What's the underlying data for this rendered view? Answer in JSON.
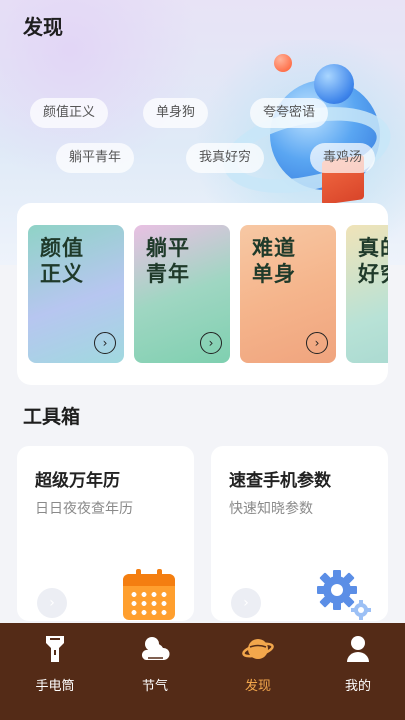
{
  "page": {
    "title": "发现"
  },
  "tags": [
    "颜值正义",
    "单身狗",
    "夸夸密语",
    "躺平青年",
    "我真好穷",
    "毒鸡汤"
  ],
  "featured_cards": [
    {
      "title": "颜值正义"
    },
    {
      "title": "躺平青年"
    },
    {
      "title": "难道单身"
    },
    {
      "title": "真的好穷"
    }
  ],
  "toolbox": {
    "title": "工具箱",
    "items": [
      {
        "title": "超级万年历",
        "subtitle": "日日夜夜查年历",
        "icon": "calendar-icon"
      },
      {
        "title": "速查手机参数",
        "subtitle": "快速知晓参数",
        "icon": "gears-icon"
      }
    ]
  },
  "nav": {
    "items": [
      {
        "label": "手电筒",
        "icon": "flashlight-icon"
      },
      {
        "label": "节气",
        "icon": "weather-icon"
      },
      {
        "label": "发现",
        "icon": "planet-icon",
        "active": true
      },
      {
        "label": "我的",
        "icon": "user-icon"
      }
    ],
    "active_color": "#f3a74c",
    "background": "#542b17"
  }
}
